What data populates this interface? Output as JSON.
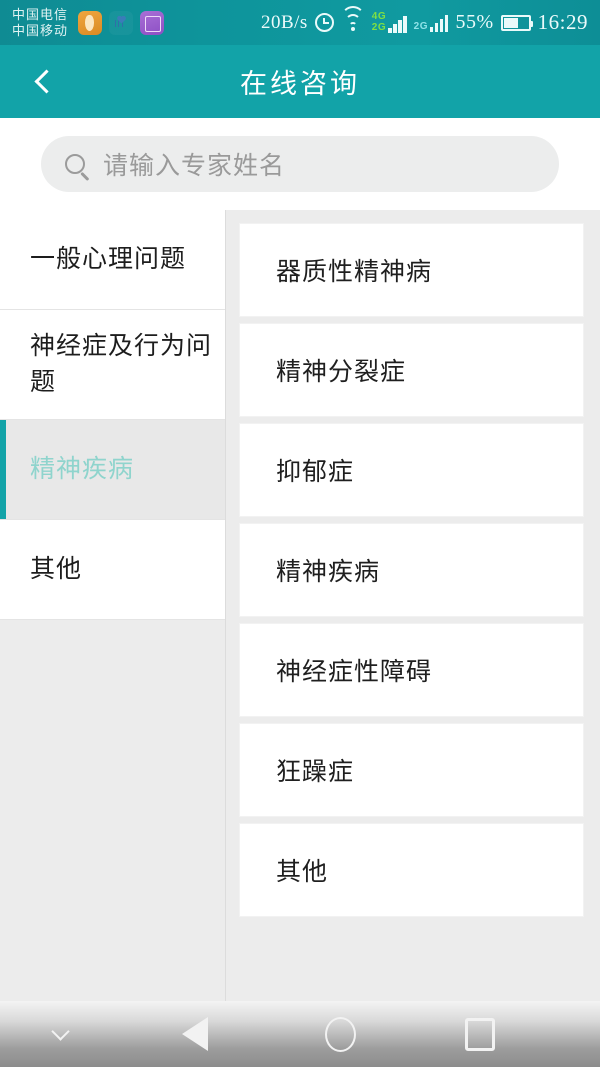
{
  "status_bar": {
    "carrier_primary": "中国电信",
    "carrier_secondary": "中国移动",
    "app_icons": [
      "orange-app-icon",
      "heartbeat-icon",
      "gallery-icon"
    ],
    "network_speed": "20B/s",
    "alarm_icon": "alarm-clock-icon",
    "wifi_icon": "wifi-icon",
    "sim1_label_top": "4G",
    "sim1_label_bottom": "2G",
    "sim2_label": "2G",
    "battery_percent": "55%",
    "time": "16:29"
  },
  "header": {
    "back_icon": "chevron-left-icon",
    "title": "在线咨询",
    "background_color": "#12a3a8"
  },
  "search": {
    "icon": "search-icon",
    "placeholder": "请输入专家姓名",
    "value": ""
  },
  "sidebar": {
    "items": [
      {
        "label": "一般心理问题",
        "selected": false
      },
      {
        "label": "神经症及行为问题",
        "selected": false
      },
      {
        "label": "精神疾病",
        "selected": true
      },
      {
        "label": "其他",
        "selected": false
      }
    ],
    "selected_indicator_color": "#12a3a8",
    "selected_text_color": "#8fd4cd"
  },
  "list": {
    "items": [
      {
        "label": "器质性精神病"
      },
      {
        "label": "精神分裂症"
      },
      {
        "label": "抑郁症"
      },
      {
        "label": "精神疾病"
      },
      {
        "label": "神经症性障碍"
      },
      {
        "label": "狂躁症"
      },
      {
        "label": "其他"
      }
    ]
  },
  "nav_bar": {
    "hide_icon": "chevron-down-icon",
    "back_icon": "triangle-back-icon",
    "home_icon": "circle-home-icon",
    "recents_icon": "square-recents-icon"
  }
}
